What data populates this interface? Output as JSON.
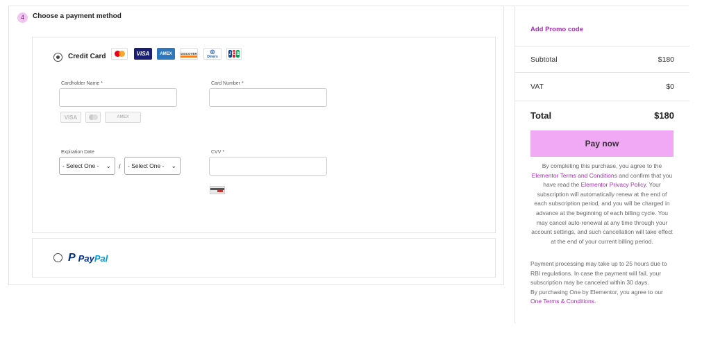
{
  "checkout": {
    "step_number": "4",
    "step_title": "Choose a payment method",
    "credit_card": {
      "label": "Credit Card",
      "selected": true,
      "card_logos": [
        "mastercard-icon",
        "visa-icon",
        "amex-icon",
        "discover-icon",
        "diners-club-icon",
        "jcb-icon"
      ],
      "logo_text": {
        "visa": "VISA",
        "amex": "AMEX",
        "discover": "DISCOVER",
        "diners": "Diners",
        "jcb": [
          "J",
          "C",
          "B"
        ]
      },
      "cardholder_label": "Cardholder Name *",
      "cardholder_value": "",
      "card_number_label": "Card Number *",
      "card_number_value": "",
      "accepted_grey_logos": [
        "VISA",
        "mastercard",
        "AMEX"
      ],
      "expiration_label": "Expiration Date",
      "month_select": "- Select One -",
      "year_select": "- Select One -",
      "date_separator": "/",
      "cvv_label": "CVV *",
      "cvv_value": ""
    },
    "paypal": {
      "selected": false,
      "brand_pay": "Pay",
      "brand_pal": "Pal"
    }
  },
  "summary": {
    "promo_link": "Add Promo code",
    "subtotal_label": "Subtotal",
    "subtotal_value": "$180",
    "vat_label": "VAT",
    "vat_value": "$0",
    "total_label": "Total",
    "total_value": "$180",
    "pay_button": "Pay now",
    "legal": {
      "t1": "By completing this purchase, you agree to the ",
      "link1": "Elementor Terms and Conditions",
      "t2": " and confirm that you have read the ",
      "link2": "Elementor Privacy Policy",
      "t3": ". Your subscription will automatically renew at the end of each subscription period, and you will be charged in advance at the beginning of each billing cycle. You may cancel auto-renewal at any time through your account settings, and such cancellation will take effect at the end of your current billing period."
    },
    "processing_note": "Payment processing may take up to 25 hours due to RBI regulations. In case the payment will fail, your subscription may be canceled within 30 days.",
    "one_note_prefix": "By purchasing One by Elementor, you agree to our ",
    "one_note_link": "One Terms & Conditions",
    "one_note_suffix": ".",
    "accent_color": "#a62fb4",
    "button_color": "#f1a8f5"
  }
}
